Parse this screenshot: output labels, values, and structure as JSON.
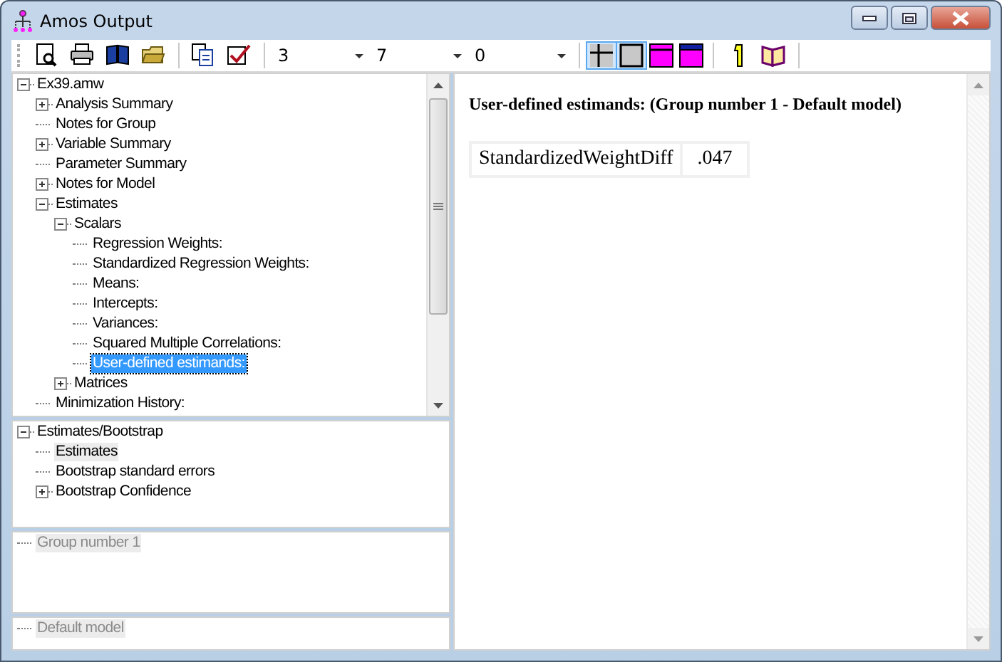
{
  "window": {
    "title": "Amos Output"
  },
  "toolbar": {
    "buttons_left": [
      {
        "kind": "preview"
      },
      {
        "kind": "print"
      },
      {
        "kind": "book"
      },
      {
        "kind": "open"
      },
      {
        "kind": "copy"
      },
      {
        "kind": "check"
      }
    ],
    "combos": [
      {
        "value": "3"
      },
      {
        "value": "7"
      },
      {
        "value": "0"
      }
    ],
    "toggles": [
      {
        "kind": "grid",
        "pressed": true
      },
      {
        "kind": "frame",
        "pressed": true
      },
      {
        "kind": "title-top",
        "pressed": false
      },
      {
        "kind": "title-dark",
        "pressed": false
      }
    ],
    "buttons_right": [
      {
        "kind": "pointer"
      },
      {
        "kind": "help"
      }
    ]
  },
  "tree_panes": [
    {
      "focused": true,
      "scrollbar": true,
      "items": [
        {
          "label": "Ex39.amw",
          "expanded": true,
          "selected": false,
          "children": [
            {
              "label": "Analysis Summary",
              "expanded": false,
              "selected": false
            },
            {
              "label": "Notes for Group",
              "selected": false
            },
            {
              "label": "Variable Summary",
              "expanded": false,
              "selected": false
            },
            {
              "label": "Parameter Summary",
              "selected": false
            },
            {
              "label": "Notes for Model",
              "expanded": false,
              "selected": false
            },
            {
              "label": "Estimates",
              "expanded": true,
              "selected": false,
              "children": [
                {
                  "label": "Scalars",
                  "expanded": true,
                  "selected": false,
                  "children": [
                    {
                      "label": "Regression Weights:",
                      "selected": false
                    },
                    {
                      "label": "Standardized Regression Weights:",
                      "selected": false
                    },
                    {
                      "label": "Means:",
                      "selected": false
                    },
                    {
                      "label": "Intercepts:",
                      "selected": false
                    },
                    {
                      "label": "Variances:",
                      "selected": false
                    },
                    {
                      "label": "Squared Multiple Correlations:",
                      "selected": false
                    },
                    {
                      "label": "User-defined estimands:",
                      "selected": true
                    }
                  ]
                },
                {
                  "label": "Matrices",
                  "expanded": false,
                  "selected": false
                }
              ]
            },
            {
              "label": "Minimization History:",
              "selected": false
            }
          ]
        }
      ]
    },
    {
      "focused": false,
      "scrollbar": false,
      "items": [
        {
          "label": "Estimates/Bootstrap",
          "expanded": true,
          "selected": false,
          "children": [
            {
              "label": "Estimates",
              "selected": true
            },
            {
              "label": "Bootstrap standard errors",
              "selected": false
            },
            {
              "label": "Bootstrap Confidence",
              "expanded": false,
              "selected": false
            }
          ]
        }
      ]
    },
    {
      "focused": false,
      "scrollbar": false,
      "items": [
        {
          "label": "Group number 1",
          "selected": true
        }
      ]
    },
    {
      "focused": false,
      "scrollbar": false,
      "items": [
        {
          "label": "Default model",
          "selected": true
        }
      ]
    }
  ],
  "output": {
    "heading": "User-defined estimands: (Group number 1 - Default model)",
    "table": {
      "rows": [
        [
          "StandardizedWeightDiff",
          ".047"
        ]
      ]
    }
  }
}
